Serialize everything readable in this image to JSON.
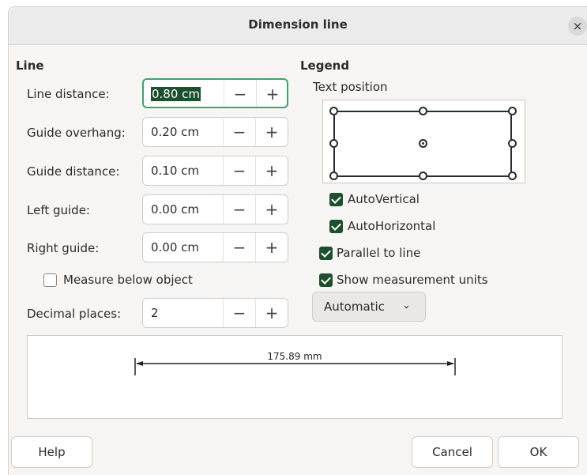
{
  "dialog": {
    "title": "Dimension line",
    "close_symbol": "×"
  },
  "line": {
    "heading": "Line",
    "fields": [
      {
        "label": "Line distance:",
        "value": "0.80 cm",
        "focused": true
      },
      {
        "label": "Guide overhang:",
        "value": "0.20 cm"
      },
      {
        "label": "Guide distance:",
        "value": "0.10 cm"
      },
      {
        "label": "Left guide:",
        "value": "0.00 cm"
      },
      {
        "label": "Right guide:",
        "value": "0.00 cm"
      }
    ],
    "measure_below": {
      "label": "Measure below object",
      "checked": false
    },
    "decimal": {
      "label": "Decimal places:",
      "value": "2"
    },
    "minus_symbol": "−",
    "plus_symbol": "+"
  },
  "legend": {
    "heading": "Legend",
    "text_position_label": "Text position",
    "selected_position": "center",
    "auto_vertical": {
      "label": "AutoVertical",
      "checked": true
    },
    "auto_horizontal": {
      "label": "AutoHorizontal",
      "checked": true
    },
    "parallel": {
      "label": "Parallel to line",
      "checked": true
    },
    "show_units": {
      "label": "Show measurement units",
      "checked": true
    },
    "unit_combo": {
      "value": "Automatic",
      "chevron": "⌄"
    }
  },
  "preview": {
    "measurement": "175.89 mm"
  },
  "buttons": {
    "help": "Help",
    "cancel": "Cancel",
    "ok": "OK"
  },
  "colors": {
    "accent": "#1c4f2d",
    "focus_border": "#3ea36a"
  }
}
